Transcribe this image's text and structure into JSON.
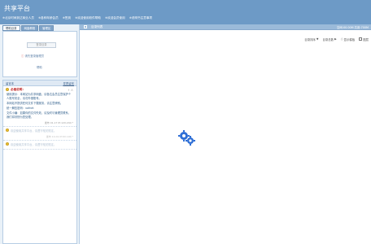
{
  "app": {
    "title": "共享平台"
  },
  "nav": [
    "※北京时间到达商业人员",
    "※各种年龄会员",
    "※签到",
    "※欢迎使用软件帮助",
    "※欢迎会员使用",
    "※说明书注意事项"
  ],
  "top_tabs": [
    "帮助目录",
    "网盘教程",
    "管理区"
  ],
  "login": {
    "button_label": "登录目录",
    "hint": "请先登录管理员",
    "help_label": "帮助"
  },
  "messages": {
    "title": "留言本",
    "post_label": "发表留言",
    "items": [
      {
        "author": "必看说明：",
        "actions": "↑ 人",
        "paragraphs": [
          "使用提示：本网站为共享网盘，请各位会员注意保护个人账号安全，请勿外借账号。",
          "本网站不提供任何文件下载服务，请注意辨别。",
          "统一解压密码：vofnet",
          "文件小编：如果你的文件失效，请及时与管理员联系，我们将尽快为您处理。"
        ],
        "meta": "发布 01-17 IP:120.240.*",
        "faded": false
      },
      {
        "author": "",
        "actions": "",
        "paragraphs": [
          "欢迎使用共享平台，请遵守相关规定。"
        ],
        "meta": "发布 10-01 IP:60.190.*",
        "faded": true
      },
      {
        "author": "",
        "actions": "",
        "paragraphs": [
          "欢迎使用共享平台，请遵守相关规定。"
        ],
        "meta": "",
        "faded": true
      }
    ]
  },
  "main": {
    "title": "目录列表",
    "space_info": "空间:00.00M 共用:700M",
    "toolbar": [
      {
        "label": "目录排序",
        "icon": "sort-icon"
      },
      {
        "label": "目录总数",
        "icon": "count-icon"
      },
      {
        "label": "显示模板",
        "icon": "template-icon"
      },
      {
        "label": "图层",
        "icon": "checkbox"
      }
    ],
    "loading_icon": "gears-icon"
  }
}
